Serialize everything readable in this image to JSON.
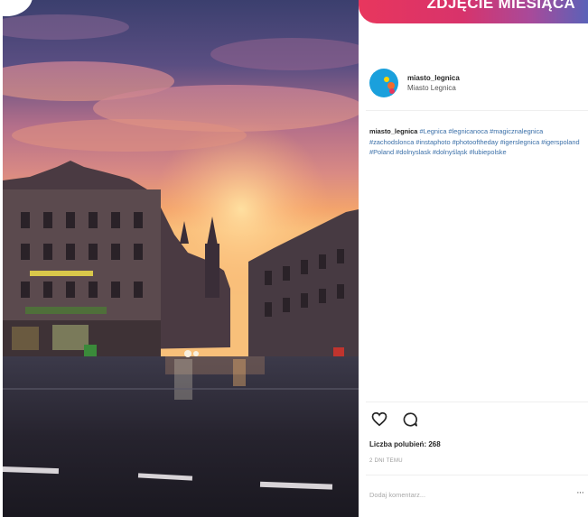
{
  "banner": {
    "title": "ZDJĘCIE MIESIĄCA"
  },
  "post": {
    "username": "miasto_legnica",
    "full_name": "Miasto Legnica",
    "caption_user": "miasto_legnica",
    "hashtags": "#Legnica #legnicanoca #magicznalegnica #zachodslonca #instaphoto #photooftheday #igerslegnica #igerspoland #Poland #dolnyslask #dolnyśląsk #lubiepolske",
    "likes_text": "Liczba polubień: 268",
    "time_ago": "2 DNI TEMU",
    "comment_placeholder": "Dodaj komentarz...",
    "more_label": "···"
  },
  "icons": {
    "like": "heart-icon",
    "comment": "comment-icon",
    "more": "more-options-icon"
  },
  "colors": {
    "banner_start": "#e8365d",
    "banner_end": "#5a62b8",
    "avatar": "#1aa0dc",
    "hashtag": "#3a6fa8"
  }
}
